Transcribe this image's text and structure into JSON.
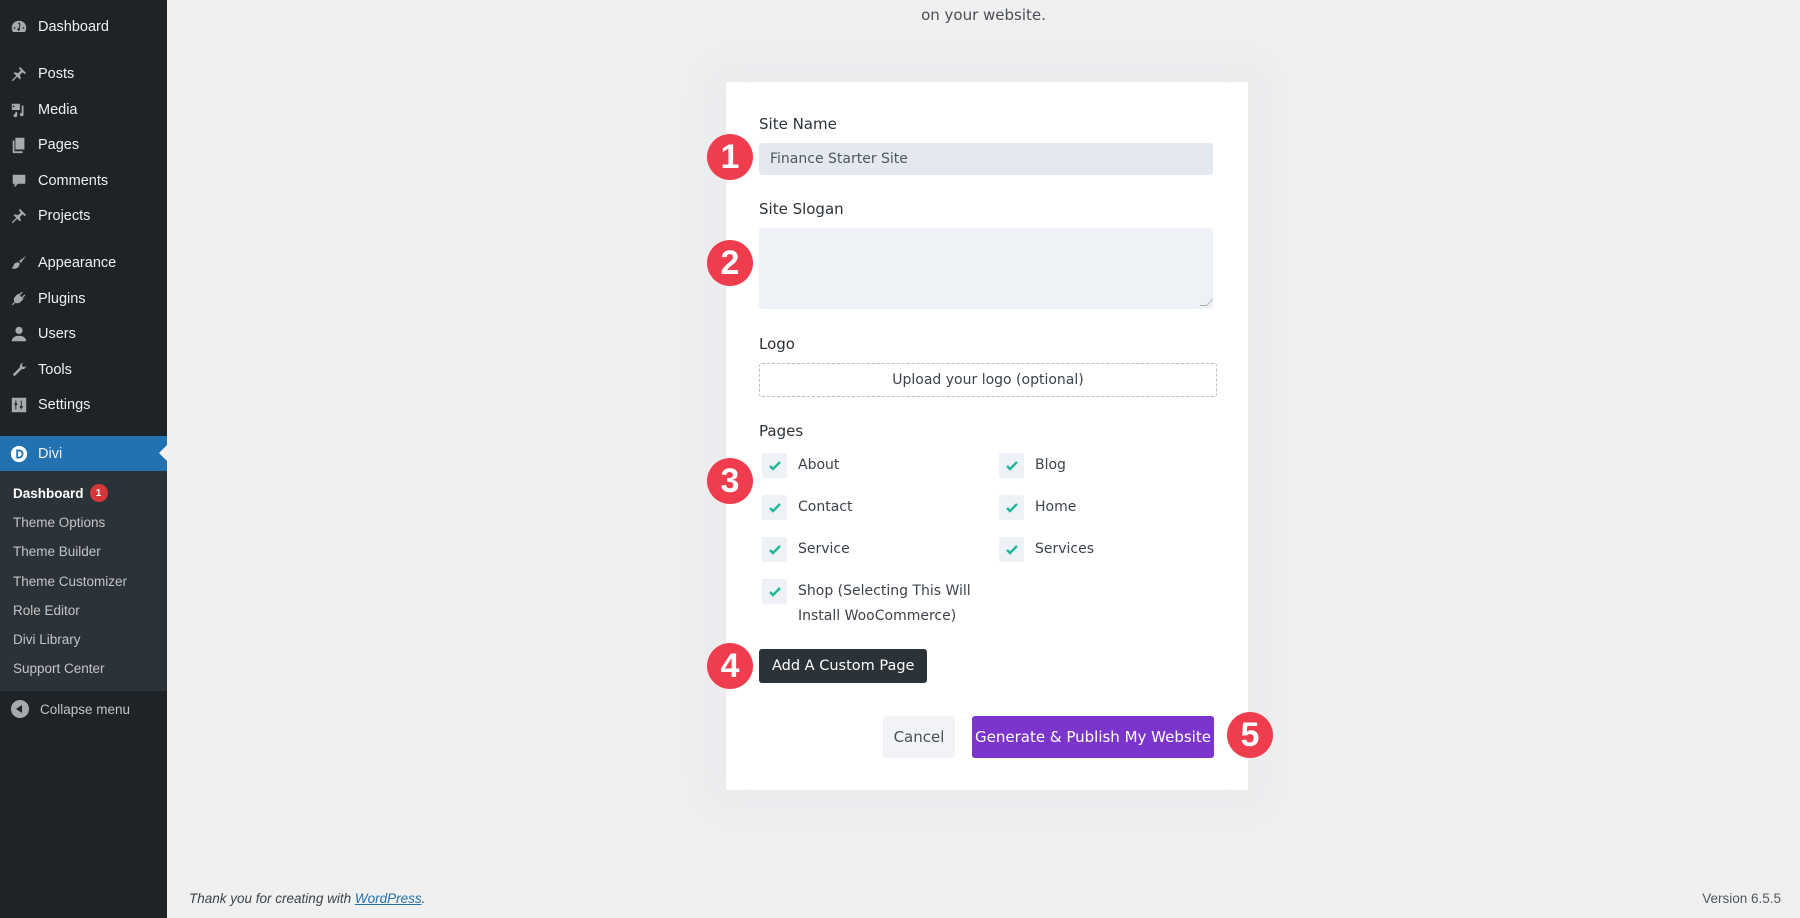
{
  "sidebar": {
    "items": [
      {
        "label": "Dashboard",
        "icon": "dashboard-icon"
      },
      {
        "label": "Posts",
        "icon": "pushpin-icon"
      },
      {
        "label": "Media",
        "icon": "media-icon"
      },
      {
        "label": "Pages",
        "icon": "pages-icon"
      },
      {
        "label": "Comments",
        "icon": "comment-icon"
      },
      {
        "label": "Projects",
        "icon": "pushpin-icon"
      },
      {
        "label": "Appearance",
        "icon": "paintbrush-icon"
      },
      {
        "label": "Plugins",
        "icon": "plugin-icon"
      },
      {
        "label": "Users",
        "icon": "user-icon"
      },
      {
        "label": "Tools",
        "icon": "wrench-icon"
      },
      {
        "label": "Settings",
        "icon": "settings-sliders-icon"
      },
      {
        "label": "Divi",
        "icon": "divi-logo-icon",
        "active": true
      }
    ],
    "submenu": [
      {
        "label": "Dashboard",
        "current": true,
        "badge": "1"
      },
      {
        "label": "Theme Options"
      },
      {
        "label": "Theme Builder"
      },
      {
        "label": "Theme Customizer"
      },
      {
        "label": "Role Editor"
      },
      {
        "label": "Divi Library"
      },
      {
        "label": "Support Center"
      }
    ],
    "collapse_label": "Collapse menu"
  },
  "intro": {
    "text": "on your website."
  },
  "form": {
    "site_name": {
      "label": "Site Name",
      "value": "Finance Starter Site"
    },
    "site_slogan": {
      "label": "Site Slogan",
      "value": ""
    },
    "logo": {
      "label": "Logo",
      "upload_label": "Upload your logo (optional)"
    },
    "pages": {
      "label": "Pages",
      "items": [
        {
          "label": "About",
          "checked": true
        },
        {
          "label": "Blog",
          "checked": true
        },
        {
          "label": "Contact",
          "checked": true
        },
        {
          "label": "Home",
          "checked": true
        },
        {
          "label": "Service",
          "checked": true
        },
        {
          "label": "Services",
          "checked": true
        },
        {
          "label": "Shop (Selecting This Will Install WooCommerce)",
          "line1": "Shop (Selecting This Will",
          "line2": "Install WooCommerce)",
          "checked": true
        }
      ]
    },
    "add_custom_page_label": "Add A Custom Page",
    "cancel_label": "Cancel",
    "publish_label": "Generate & Publish My Website"
  },
  "steps": [
    "1",
    "2",
    "3",
    "4",
    "5"
  ],
  "colors": {
    "sidebar_bg": "#1d2327",
    "active_blue": "#2271b1",
    "primary_purple": "#7b35cc",
    "step_red": "#ef3d4d",
    "check_teal": "#1fb89a"
  },
  "footer": {
    "thanks_prefix": "Thank you for creating with ",
    "link_text": "WordPress",
    "thanks_suffix": ".",
    "version": "Version 6.5.5"
  }
}
